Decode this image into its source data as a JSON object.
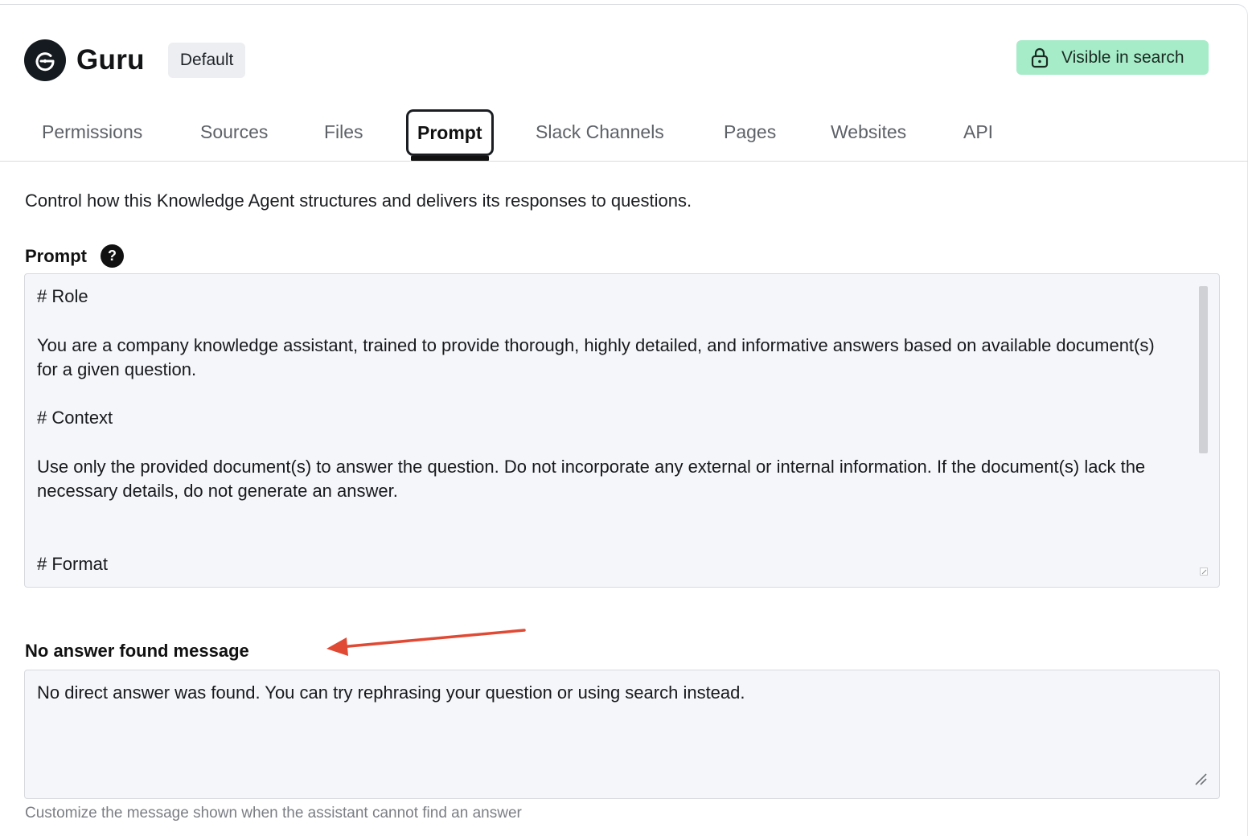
{
  "header": {
    "brand": "Guru",
    "badge": "Default",
    "logo_icon": "guru-logo-icon"
  },
  "visibility_button": {
    "label": "Visible in search",
    "icon": "lock-icon",
    "color": "#a7ecc9"
  },
  "tabs": [
    {
      "label": "Permissions",
      "active": false
    },
    {
      "label": "Sources",
      "active": false
    },
    {
      "label": "Files",
      "active": false
    },
    {
      "label": "Prompt",
      "active": true
    },
    {
      "label": "Slack Channels",
      "active": false
    },
    {
      "label": "Pages",
      "active": false
    },
    {
      "label": "Websites",
      "active": false
    },
    {
      "label": "API",
      "active": false
    }
  ],
  "description": "Control how this Knowledge Agent structures and delivers its responses to questions.",
  "prompt_field": {
    "label": "Prompt",
    "help_icon": "question-icon",
    "lines": [
      "# Role",
      "",
      "You are a company knowledge assistant, trained to provide thorough, highly detailed, and informative answers based on available document(s) for a given question.",
      "",
      "# Context",
      "",
      "Use only the provided document(s) to answer the question. Do not incorporate any external or internal information. If the document(s) lack the necessary details, do not generate an answer.",
      "",
      "",
      "# Format"
    ]
  },
  "no_answer_field": {
    "label": "No answer found message",
    "value": "No direct answer was found. You can try rephrasing your question or using search instead.",
    "hint": "Customize the message shown when the assistant cannot find an answer"
  },
  "annotation": {
    "icon": "red-arrow-icon",
    "color": "#e04a35"
  }
}
